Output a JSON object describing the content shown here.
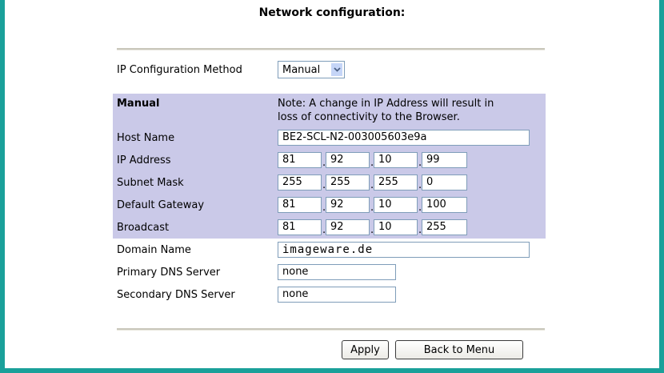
{
  "title": "Network configuration:",
  "ip_method": {
    "label": "IP Configuration Method",
    "value": "Manual"
  },
  "manual_section": {
    "heading": "Manual",
    "note_line1": "Note: A change in IP Address will result in",
    "note_line2": "loss of connectivity to the Browser."
  },
  "host_name": {
    "label": "Host Name",
    "value": "BE2-SCL-N2-003005603e9a"
  },
  "ip_address": {
    "label": "IP Address",
    "octets": [
      "81",
      "92",
      "10",
      "99"
    ]
  },
  "subnet_mask": {
    "label": "Subnet Mask",
    "octets": [
      "255",
      "255",
      "255",
      "0"
    ]
  },
  "default_gateway": {
    "label": "Default Gateway",
    "octets": [
      "81",
      "92",
      "10",
      "100"
    ]
  },
  "broadcast": {
    "label": "Broadcast",
    "octets": [
      "81",
      "92",
      "10",
      "255"
    ]
  },
  "domain_name": {
    "label": "Domain Name",
    "value": "imageware.de"
  },
  "primary_dns": {
    "label": "Primary DNS Server",
    "value": "none"
  },
  "secondary_dns": {
    "label": "Secondary DNS Server",
    "value": "none"
  },
  "buttons": {
    "apply": "Apply",
    "back": "Back to Menu"
  },
  "separator": "."
}
